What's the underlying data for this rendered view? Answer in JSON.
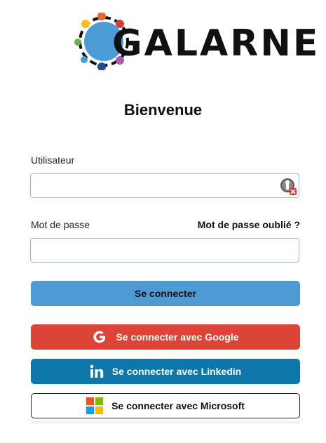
{
  "brand": {
    "name": "GALARNE"
  },
  "page": {
    "title": "Bienvenue"
  },
  "form": {
    "username_label": "Utilisateur",
    "username_value": "",
    "password_label": "Mot de passe",
    "password_value": "",
    "forgot_link": "Mot de passe oublié ?",
    "submit_label": "Se connecter"
  },
  "social": {
    "google_label": "Se connecter avec Google",
    "linkedin_label": "Se connecter avec Linkedin",
    "microsoft_label": "Se connecter avec Microsoft"
  },
  "colors": {
    "primary": "#4f9ad4",
    "google": "#db4437",
    "linkedin": "#0e76a8",
    "input_border": "#9dbbe0"
  },
  "icons": {
    "password_manager": "key-icon",
    "google": "google-icon",
    "linkedin": "linkedin-icon",
    "microsoft": "microsoft-icon"
  }
}
